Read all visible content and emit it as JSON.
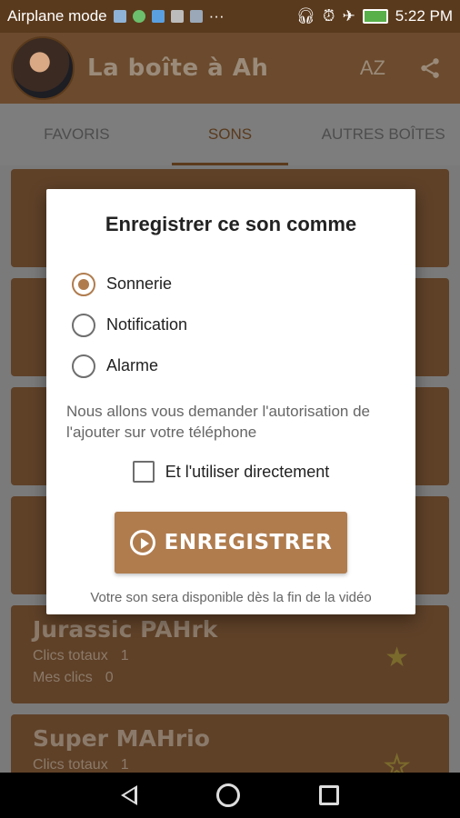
{
  "status_bar": {
    "mode": "Airplane mode",
    "time": "5:22 PM",
    "more": "···"
  },
  "app_bar": {
    "title": "La boîte à Ah",
    "sort_label": "AZ",
    "share_icon": "share-icon"
  },
  "tabs": [
    {
      "label": "FAVORIS"
    },
    {
      "label": "SONS"
    },
    {
      "label": "AUTRES BOÎTES"
    }
  ],
  "cards": [
    {
      "title": "Jurassic PAHrk",
      "total_label": "Clics totaux",
      "total": "1",
      "mine_label": "Mes clics",
      "mine": "0",
      "favorite": true
    },
    {
      "title": "Super MAHrio",
      "total_label": "Clics totaux",
      "total": "1",
      "favorite": false
    }
  ],
  "dialog": {
    "title": "Enregistrer ce son comme",
    "options": [
      {
        "label": "Sonnerie",
        "checked": true
      },
      {
        "label": "Notification",
        "checked": false
      },
      {
        "label": "Alarme",
        "checked": false
      }
    ],
    "info": "Nous allons vous demander l'autorisation de l'ajouter sur votre téléphone",
    "checkbox_label": "Et l'utiliser directement",
    "button_label": "ENREGISTRER",
    "footnote": "Votre son sera disponible dès la fin de la vidéo"
  },
  "colors": {
    "accent": "#b07c4e",
    "app_bar": "#6b4a2d",
    "status_bar": "#5a3a1c"
  }
}
